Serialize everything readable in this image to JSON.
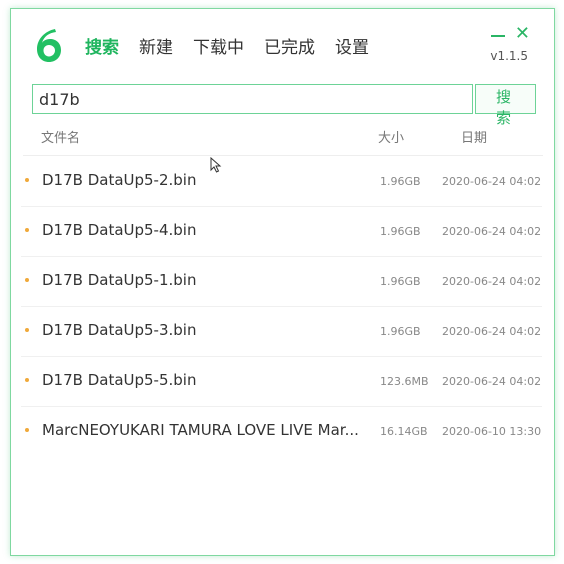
{
  "nav": {
    "items": [
      {
        "label": "搜索",
        "active": true
      },
      {
        "label": "新建",
        "active": false
      },
      {
        "label": "下载中",
        "active": false
      },
      {
        "label": "已完成",
        "active": false
      },
      {
        "label": "设置",
        "active": false
      }
    ]
  },
  "app": {
    "logo_text": "6",
    "version": "v1.1.5"
  },
  "search": {
    "value": "d17b",
    "button_label": "搜 索"
  },
  "table": {
    "headers": {
      "name": "文件名",
      "size": "大小",
      "date": "日期"
    },
    "rows": [
      {
        "name": "D17B DataUp5-2.bin",
        "size": "1.96GB",
        "date": "2020-06-24 04:02"
      },
      {
        "name": "D17B DataUp5-4.bin",
        "size": "1.96GB",
        "date": "2020-06-24 04:02"
      },
      {
        "name": "D17B DataUp5-1.bin",
        "size": "1.96GB",
        "date": "2020-06-24 04:02"
      },
      {
        "name": "D17B DataUp5-3.bin",
        "size": "1.96GB",
        "date": "2020-06-24 04:02"
      },
      {
        "name": "D17B DataUp5-5.bin",
        "size": "123.6MB",
        "date": "2020-06-24 04:02"
      },
      {
        "name": "MarcNEOYUKARI TAMURA LOVE LIVE Mar...",
        "size": "16.14GB",
        "date": "2020-06-10 13:30"
      }
    ]
  },
  "colors": {
    "accent": "#2ab565",
    "dot": "#f0a93a"
  }
}
